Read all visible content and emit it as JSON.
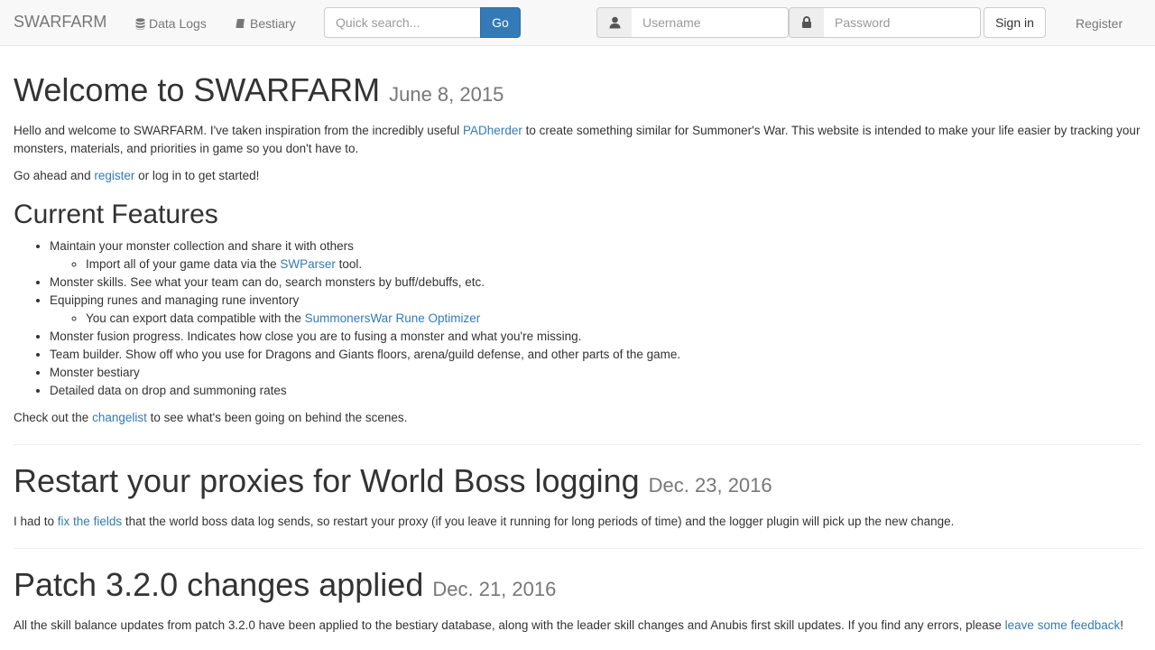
{
  "navbar": {
    "brand": "SWARFARM",
    "data_logs": "Data Logs",
    "bestiary": "Bestiary",
    "search_placeholder": "Quick search...",
    "search_button": "Go",
    "username_placeholder": "Username",
    "password_placeholder": "Password",
    "signin": "Sign in",
    "register": "Register"
  },
  "welcome": {
    "title": "Welcome to SWARFARM",
    "date": "June 8, 2015",
    "intro_before": "Hello and welcome to SWARFARM. I've taken inspiration from the incredibly useful ",
    "intro_link": "PADherder",
    "intro_after": " to create something similar for Summoner's War. This website is intended to make your life easier by tracking your monsters, materials, and priorities in game so you don't have to.",
    "go_before": "Go ahead and ",
    "go_link": "register",
    "go_after": " or log in to get started!",
    "features_heading": "Current Features",
    "features": {
      "f1": "Maintain your monster collection and share it with others",
      "f1_sub_before": "Import all of your game data via the ",
      "f1_sub_link": "SWParser",
      "f1_sub_after": " tool.",
      "f2": "Monster skills. See what your team can do, search monsters by buff/debuffs, etc.",
      "f3": "Equipping runes and managing rune inventory",
      "f3_sub_before": "You can export data compatible with the ",
      "f3_sub_link": "SummonersWar Rune Optimizer",
      "f4": "Monster fusion progress. Indicates how close you are to fusing a monster and what you're missing.",
      "f5": "Team builder. Show off who you use for Dragons and Giants floors, arena/guild defense, and other parts of the game.",
      "f6": "Monster bestiary",
      "f7": "Detailed data on drop and summoning rates"
    },
    "check_before": "Check out the ",
    "check_link": "changelist",
    "check_after": " to see what's been going on behind the scenes."
  },
  "post2": {
    "title": "Restart your proxies for World Boss logging",
    "date": "Dec. 23, 2016",
    "body_before": "I had to ",
    "body_link": "fix the fields",
    "body_after": " that the world boss data log sends, so restart your proxy (if you leave it running for long periods of time) and the logger plugin will pick up the new change."
  },
  "post3": {
    "title": "Patch 3.2.0 changes applied",
    "date": "Dec. 21, 2016",
    "body_before": "All the skill balance updates from patch 3.2.0 have been applied to the bestiary database, along with the leader skill changes and Anubis first skill updates. If you find any errors, please ",
    "body_link": "leave some feedback",
    "body_after": "!"
  },
  "colors": {
    "link": "#337ab7",
    "primary_button": "#337ab7",
    "navbar_bg": "#f8f8f8"
  }
}
